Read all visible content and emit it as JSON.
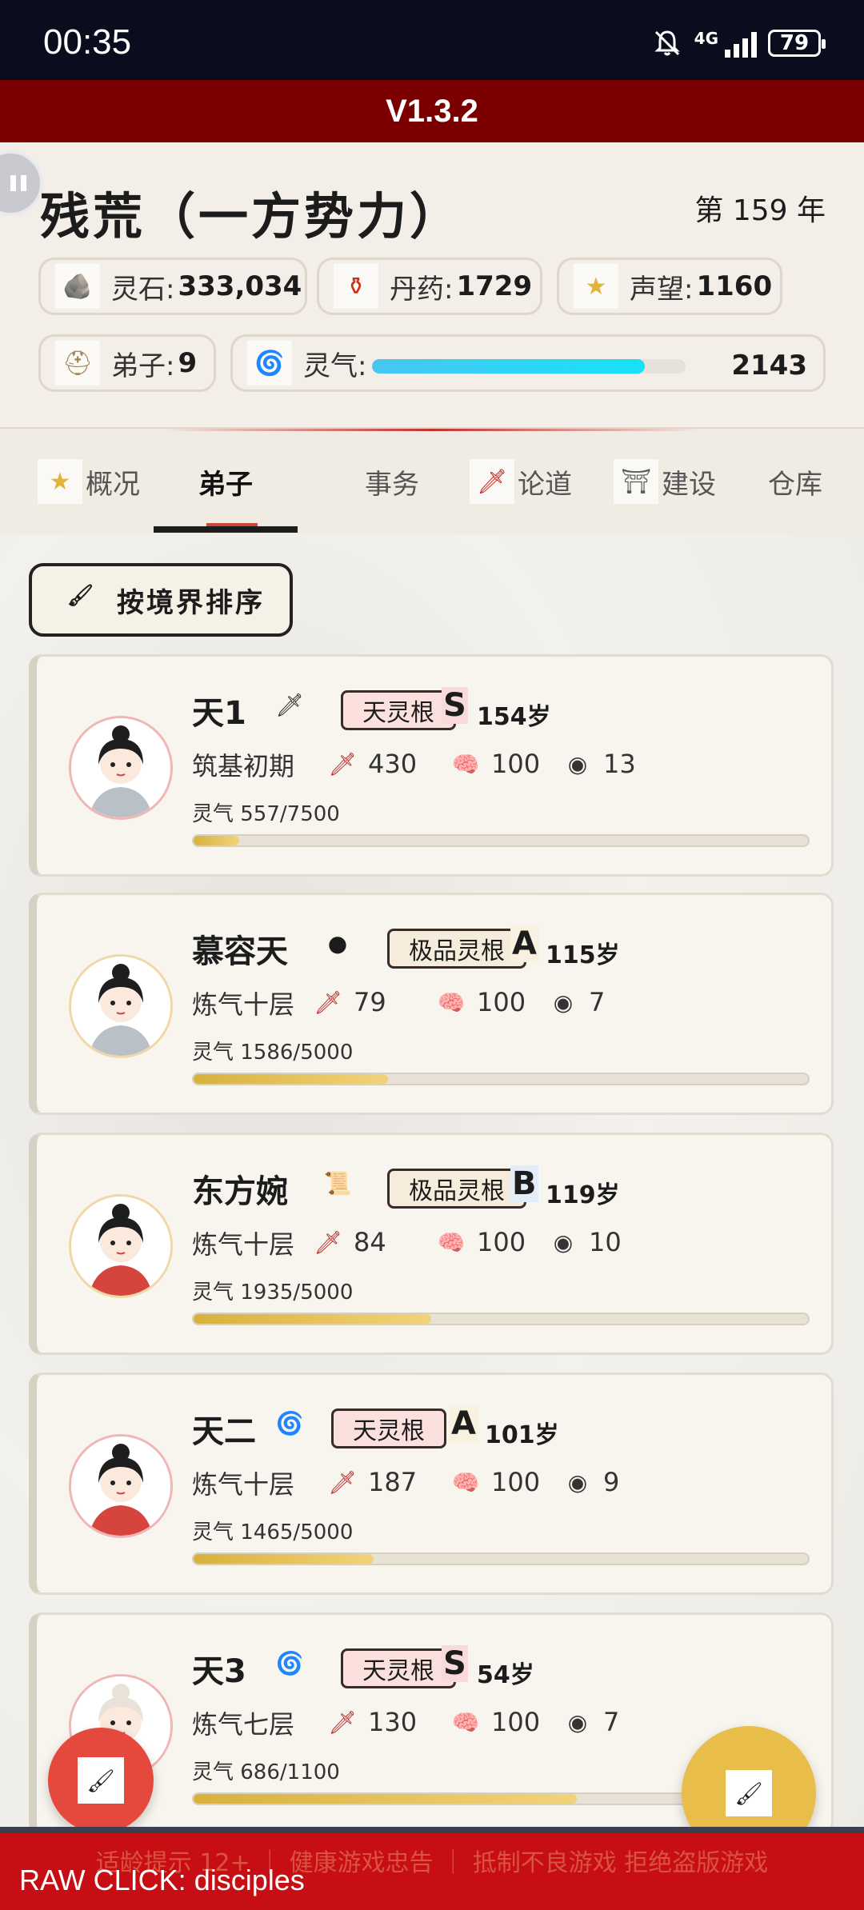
{
  "status_bar": {
    "time": "00:35",
    "network": "4G",
    "battery": "79"
  },
  "version": "V1.3.2",
  "header": {
    "faction_name": "残荒（一方势力）",
    "year": "第 159 年",
    "resources": {
      "spirit_stone": {
        "label": "灵石:",
        "value": "333,034",
        "icon": "spirit-stone-icon"
      },
      "pills": {
        "label": "丹药:",
        "value": "1729",
        "icon": "gourd-icon"
      },
      "reputation": {
        "label": "声望:",
        "value": "1160",
        "icon": "star-icon"
      },
      "disciples": {
        "label": "弟子:",
        "value": "9",
        "icon": "disciple-icon"
      },
      "qi": {
        "label": "灵气:",
        "value": "2143",
        "fill": 0.87,
        "icon": "qi-swirl-icon"
      }
    }
  },
  "tabs": [
    {
      "label": "概况",
      "icon": "star-icon"
    },
    {
      "label": "弟子",
      "active": true
    },
    {
      "label": "事务"
    },
    {
      "label": "论道",
      "icon": "sword-icon"
    },
    {
      "label": "建设",
      "icon": "pavilion-icon"
    },
    {
      "label": "仓库"
    }
  ],
  "sort_button": {
    "label": "按境界排序",
    "icon": "brush-icon"
  },
  "disciples": [
    {
      "name": "天1",
      "badge_icon": "sword-icon",
      "root": "天灵根",
      "grade": "S",
      "age": "154岁",
      "realm": "筑基初期",
      "attack": "430",
      "mind": "100",
      "defense": "13",
      "qi_text": "灵气 557/7500",
      "qi_fill": 0.074
    },
    {
      "name": "慕容天",
      "badge_icon": "stone-icon",
      "root": "极品灵根",
      "grade": "A",
      "age": "115岁",
      "realm": "炼气十层",
      "attack": "79",
      "mind": "100",
      "defense": "7",
      "qi_text": "灵气 1586/5000",
      "qi_fill": 0.317
    },
    {
      "name": "东方婉",
      "badge_icon": "scroll-icon",
      "root": "极品灵根",
      "grade": "B",
      "age": "119岁",
      "realm": "炼气十层",
      "attack": "84",
      "mind": "100",
      "defense": "10",
      "qi_text": "灵气 1935/5000",
      "qi_fill": 0.387
    },
    {
      "name": "天二",
      "badge_icon": "qi-swirl-icon",
      "root": "天灵根",
      "grade": "A",
      "age": "101岁",
      "realm": "炼气十层",
      "attack": "187",
      "mind": "100",
      "defense": "9",
      "qi_text": "灵气 1465/5000",
      "qi_fill": 0.293
    },
    {
      "name": "天3",
      "badge_icon": "qi-swirl-icon",
      "root": "天灵根",
      "grade": "S",
      "age": "54岁",
      "realm": "炼气七层",
      "attack": "130",
      "mind": "100",
      "defense": "7",
      "qi_text": "灵气 686/1100",
      "qi_fill": 0.624
    }
  ],
  "banner": {
    "faint_text": "适龄提示 12+ ｜ 健康游戏忠告 ｜ 抵制不良游戏 拒绝盗版游戏",
    "raw_click": "RAW CLICK: disciples"
  },
  "colors": {
    "accent_red": "#7a0000",
    "banner_red": "#c60e14",
    "qi_blue": "#1fd5f5",
    "progress_gold": "#e2c05a"
  }
}
